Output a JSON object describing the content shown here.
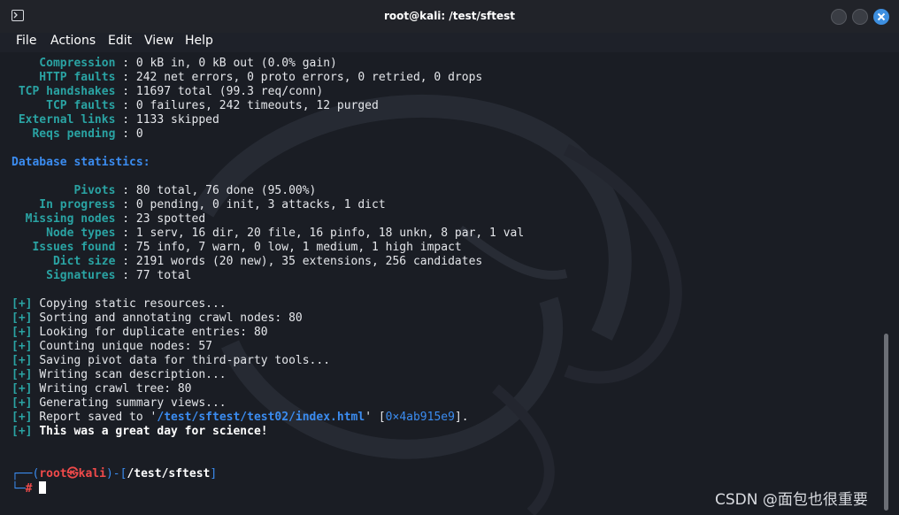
{
  "window": {
    "title": "root@kali: /test/sftest"
  },
  "menu": [
    "File",
    "Actions",
    "Edit",
    "View",
    "Help"
  ],
  "http_stats": [
    {
      "label": "    Compression",
      "value": "0 kB in, 0 kB out (0.0% gain)"
    },
    {
      "label": "    HTTP faults",
      "value": "242 net errors, 0 proto errors, 0 retried, 0 drops"
    },
    {
      "label": " TCP handshakes",
      "value": "11697 total (99.3 req/conn)"
    },
    {
      "label": "     TCP faults",
      "value": "0 failures, 242 timeouts, 12 purged"
    },
    {
      "label": " External links",
      "value": "1133 skipped"
    },
    {
      "label": "   Reqs pending",
      "value": "0"
    }
  ],
  "db_heading": "Database statistics:",
  "db_stats": [
    {
      "label": "         Pivots",
      "value": "80 total, 76 done (95.00%)"
    },
    {
      "label": "    In progress",
      "value": "0 pending, 0 init, 3 attacks, 1 dict"
    },
    {
      "label": "  Missing nodes",
      "value": "23 spotted"
    },
    {
      "label": "     Node types",
      "value": "1 serv, 16 dir, 20 file, 16 pinfo, 18 unkn, 8 par, 1 val"
    },
    {
      "label": "   Issues found",
      "value": "75 info, 7 warn, 0 low, 1 medium, 1 high impact"
    },
    {
      "label": "      Dict size",
      "value": "2191 words (20 new), 35 extensions, 256 candidates"
    },
    {
      "label": "     Signatures",
      "value": "77 total"
    }
  ],
  "log_marker": "[+]",
  "log_lines": [
    "Copying static resources...",
    "Sorting and annotating crawl nodes: 80",
    "Looking for duplicate entries: 80",
    "Counting unique nodes: 57",
    "Saving pivot data for third-party tools...",
    "Writing scan description...",
    "Writing crawl tree: 80",
    "Generating summary views..."
  ],
  "report": {
    "prefix": "Report saved to '",
    "path": "/test/sftest/test02/index.html",
    "mid": "' [",
    "hash": "0×4ab915e9",
    "suffix": "]."
  },
  "science_line": "This was a great day for science!",
  "prompt": {
    "corner_top": "┌──(",
    "user": "root",
    "at": "㉿",
    "host": "kali",
    "sep": ")-[",
    "cwd": "/test/sftest",
    "close": "]",
    "corner_bottom": "└─",
    "hash": "#"
  },
  "watermark": "CSDN @面包也很重要",
  "colors": {
    "label_teal": "#2aa3a3",
    "heading_blue": "#3b8cf0",
    "prompt_red": "#f04a4a",
    "close_button": "#3d8fe0",
    "background": "#1a1d24"
  },
  "icons": [
    "terminal-icon",
    "minimize-icon",
    "maximize-icon",
    "close-icon"
  ]
}
